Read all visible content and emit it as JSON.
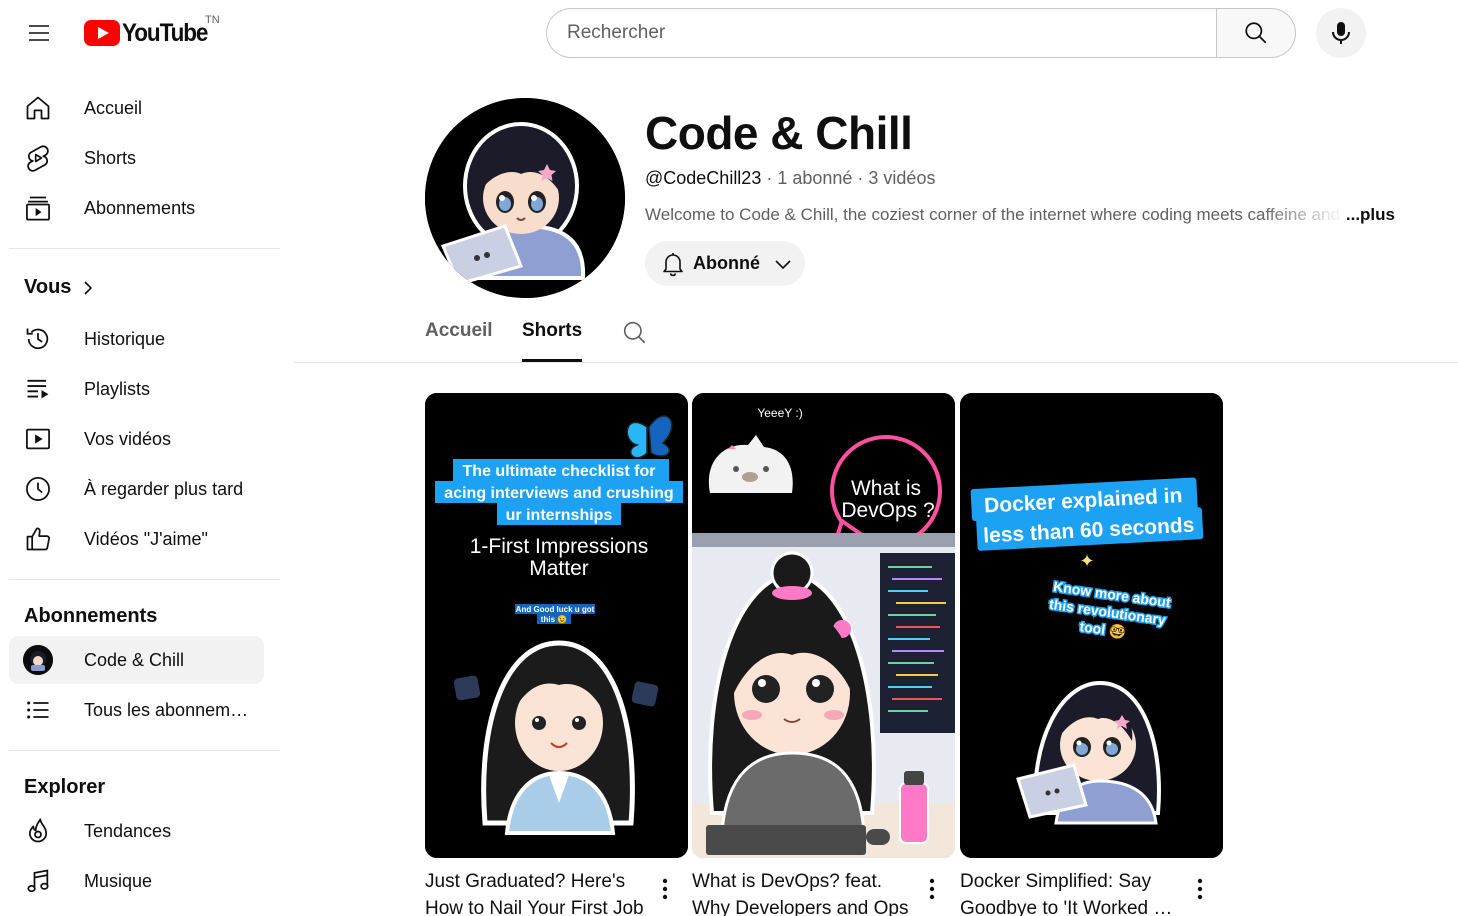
{
  "header": {
    "logo_text": "YouTube",
    "country_code": "TN",
    "search_placeholder": "Rechercher"
  },
  "sidebar": {
    "main": [
      {
        "label": "Accueil",
        "icon": "home-icon"
      },
      {
        "label": "Shorts",
        "icon": "shorts-icon"
      },
      {
        "label": "Abonnements",
        "icon": "subscriptions-icon"
      }
    ],
    "you_title": "Vous",
    "you": [
      {
        "label": "Historique",
        "icon": "history-icon"
      },
      {
        "label": "Playlists",
        "icon": "playlists-icon"
      },
      {
        "label": "Vos vidéos",
        "icon": "your-videos-icon"
      },
      {
        "label": "À regarder plus tard",
        "icon": "watch-later-icon"
      },
      {
        "label": "Vidéos \"J'aime\"",
        "icon": "liked-videos-icon"
      }
    ],
    "subs_title": "Abonnements",
    "subs": [
      {
        "label": "Code & Chill",
        "icon": "channel-avatar"
      },
      {
        "label": "Tous les abonnements",
        "icon": "list-icon"
      }
    ],
    "explore_title": "Explorer",
    "explore": [
      {
        "label": "Tendances",
        "icon": "trending-icon"
      },
      {
        "label": "Musique",
        "icon": "music-icon"
      }
    ]
  },
  "channel": {
    "name": "Code & Chill",
    "handle": "@CodeChill23",
    "meta": " · 1 abonné · 3 vidéos",
    "description": "Welcome to Code & Chill, the coziest corner of the internet where coding meets caffeine and good vibes",
    "more_label": "...plus",
    "subscribe_label": "Abonné"
  },
  "tabs": [
    {
      "label": "Accueil",
      "active": false
    },
    {
      "label": "Shorts",
      "active": true
    }
  ],
  "shorts": [
    {
      "title_line1": "Just Graduated? Here's",
      "title_line2": "How to Nail Your First Job",
      "thumb_caption": "The ultimate checklist for acing interviews and crushing ur internships",
      "thumb_heading_1": "1-First Impressions",
      "thumb_heading_2": "Matter",
      "thumb_small_1": "And Good luck u got",
      "thumb_small_2": "this 😉"
    },
    {
      "title_line1": "What is DevOps? feat.",
      "title_line2": "Why Developers and Ops",
      "thumb_top_text": "YeeeY :)",
      "thumb_bubble_1": "What is",
      "thumb_bubble_2": "DevOps ?"
    },
    {
      "title_line1": "Docker Simplified: Say",
      "title_line2": "Goodbye to 'It Worked on My Machine'",
      "thumb_caption_1": "Docker explained in",
      "thumb_caption_2": "less than 60 seconds",
      "thumb_sub_1": "Know more about",
      "thumb_sub_2": "this revolutionary",
      "thumb_sub_3": "tool 🤓"
    }
  ],
  "colors": {
    "brand_red": "#ff0000",
    "text_primary": "#0f0f0f",
    "text_secondary": "#606060",
    "caption_blue": "#1da1f2"
  }
}
